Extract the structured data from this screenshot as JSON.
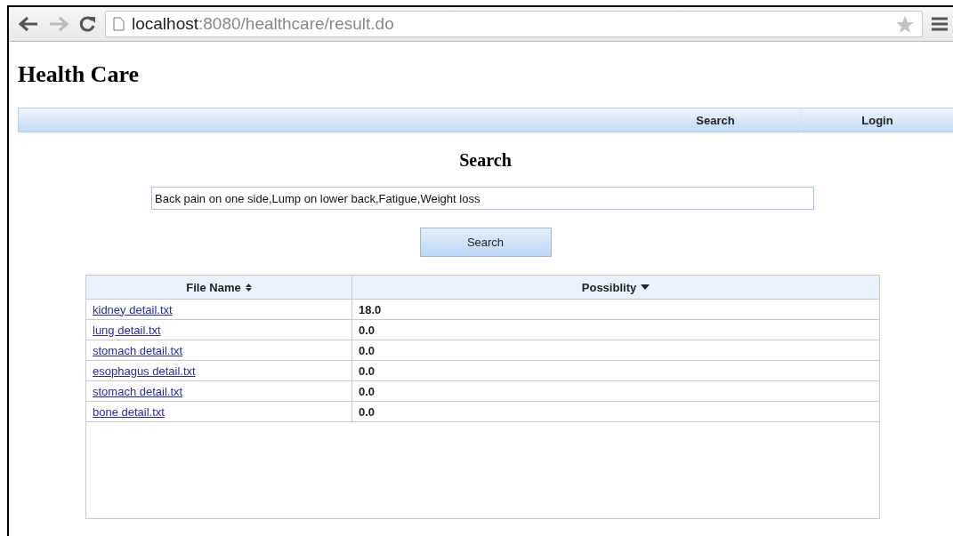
{
  "browser": {
    "url_host": "localhost",
    "url_rest": ":8080/healthcare/result.do"
  },
  "site_title": "Health Care",
  "nav": [
    {
      "label": "Search"
    },
    {
      "label": "Login"
    }
  ],
  "heading": "Search",
  "search": {
    "value": "Back pain on one side,Lump on lower back,Fatigue,Weight loss"
  },
  "search_button": "Search",
  "table": {
    "columns": [
      {
        "label": "File Name",
        "sorted": false
      },
      {
        "label": "Possiblity",
        "sorted": true
      }
    ],
    "rows": [
      {
        "file": "kidney detail.txt",
        "value": "18.0"
      },
      {
        "file": "lung detail.txt",
        "value": "0.0"
      },
      {
        "file": "stomach detail.txt",
        "value": "0.0"
      },
      {
        "file": "esophagus detail.txt",
        "value": "0.0"
      },
      {
        "file": "stomach detail.txt",
        "value": "0.0"
      },
      {
        "file": "bone detail.txt",
        "value": "0.0"
      }
    ]
  }
}
